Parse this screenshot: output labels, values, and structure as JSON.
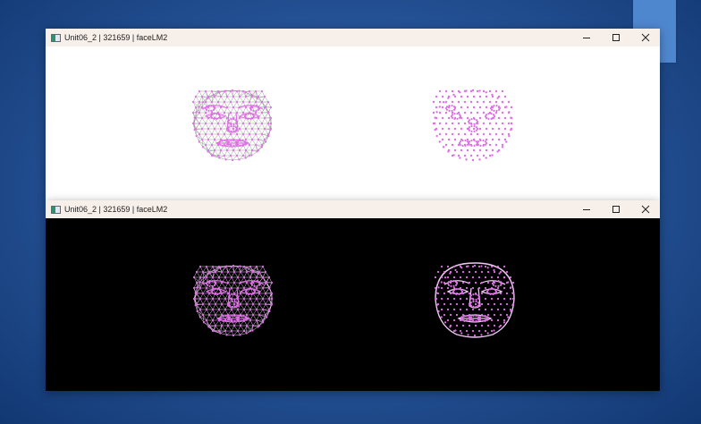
{
  "windows": [
    {
      "title": "Unit06_2 | 321659 | faceLM2",
      "background": "#ffffff",
      "mesh_color": "#9a9a9a",
      "point_color": "#e070e8"
    },
    {
      "title": "Unit06_2 | 321659 | faceLM2",
      "background": "#000000",
      "mesh_color": "#f0c8f4",
      "point_color": "#e070e8"
    }
  ],
  "controls": {
    "minimize_icon": "minimize-icon",
    "maximize_icon": "maximize-icon",
    "close_icon": "close-icon"
  }
}
